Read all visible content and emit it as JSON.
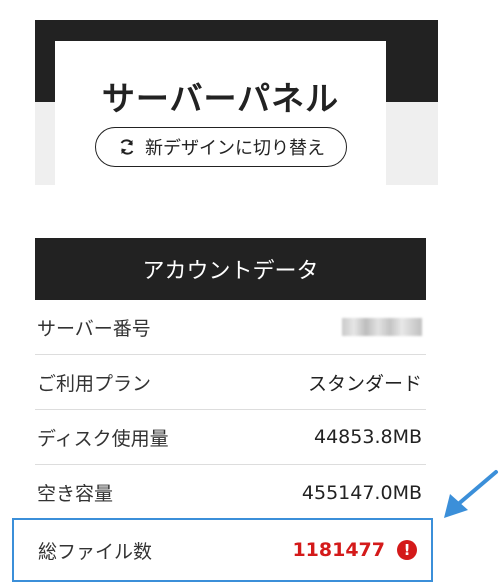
{
  "server_panel": {
    "title": "サーバーパネル",
    "switch_button_label": "新デザインに切り替え",
    "switch_icon": "refresh-icon"
  },
  "account_data": {
    "heading": "アカウントデータ",
    "rows": [
      {
        "label": "サーバー番号",
        "value": ""
      },
      {
        "label": "ご利用プラン",
        "value": "スタンダード"
      },
      {
        "label": "ディスク使用量",
        "value": "44853.8MB"
      },
      {
        "label": "空き容量",
        "value": "455147.0MB"
      },
      {
        "label": "総ファイル数",
        "value": "1181477"
      }
    ],
    "warning_icon": "exclamation-icon"
  },
  "colors": {
    "dark": "#222222",
    "warning_red": "#d41a1a",
    "highlight_blue": "#3b8fd9"
  }
}
